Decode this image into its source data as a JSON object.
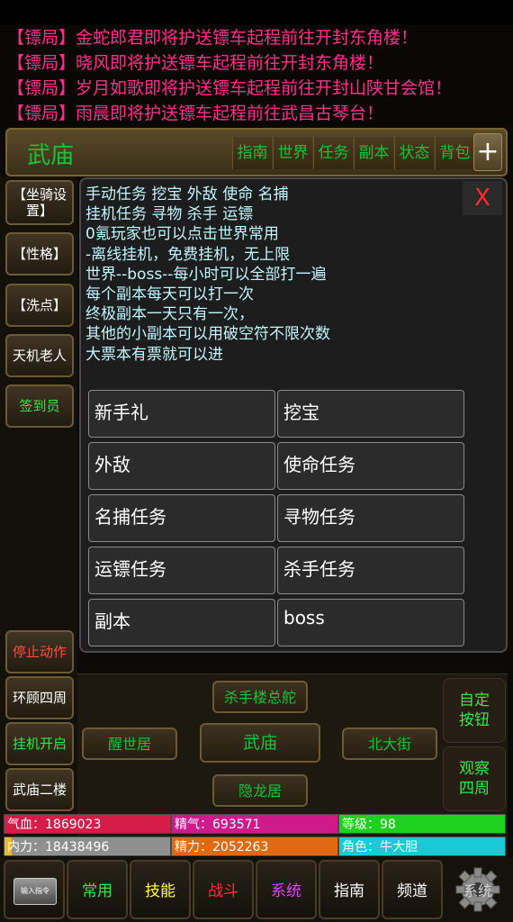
{
  "chat": {
    "lines": [
      "【镖局】金蛇郎君即将护送镖车起程前往开封东角楼！",
      "【镖局】晓风即将护送镖车起程前往开封东角楼！",
      "【镖局】岁月如歌即将护送镖车起程前往开封山陕甘会馆！",
      "【镖局】雨晨即将护送镖车起程前往武昌古琴台！"
    ]
  },
  "topbar": {
    "scene": "武庙",
    "tabs": [
      "指南",
      "世界",
      "任务",
      "副本",
      "状态",
      "背包"
    ],
    "plus": "+"
  },
  "sidebar": {
    "buttons": [
      "【坐骑设置】",
      "【性格】",
      "【洗点】",
      "天机老人",
      "签到员"
    ],
    "actions": [
      "停止动作",
      "环顾四周",
      "挂机开启",
      "武庙二楼"
    ]
  },
  "dialog": {
    "close": "X",
    "lines": [
      "手动任务 挖宝 外敌 使命 名捕",
      "挂机任务 寻物 杀手 运镖",
      "0氪玩家也可以点击世界常用",
      "-离线挂机，免费挂机，无上限",
      "世界--boss--每小时可以全部打一遍",
      "每个副本每天可以打一次",
      "终极副本一天只有一次，",
      "其他的小副本可以用破空符不限次数",
      "大票本有票就可以进"
    ],
    "options": [
      "新手礼",
      "挖宝",
      "外敌",
      "使命任务",
      "名捕任务",
      "寻物任务",
      "运镖任务",
      "杀手任务",
      "副本",
      "boss"
    ]
  },
  "map": {
    "north": "杀手楼总舵",
    "west": "醒世居",
    "center": "武庙",
    "east": "北大街",
    "south": "隐龙居",
    "custom": "自定按钮",
    "observe": "观察四周"
  },
  "stats": {
    "hp": "气血：1869023",
    "jingqi": "精气：693571",
    "level": "等级：98",
    "neili": "内力：18438496",
    "jingli": "精力：2052263",
    "role": "角色：牛大胆",
    "colors": {
      "hp": "#d81c4a",
      "jingqi": "#d01a8c",
      "level": "#1fd01f",
      "neili": "#8f8f8f",
      "jingli": "#e06a12",
      "role": "#19c9d4"
    }
  },
  "toolbar": {
    "cmd": "输入指令",
    "buttons": [
      "常用",
      "技能",
      "战斗",
      "系统",
      "指南",
      "频道"
    ],
    "colors": [
      "#39e34a",
      "#ffff33",
      "#ff3030",
      "#e040ff",
      "#ffffff",
      "#ffffff"
    ],
    "gear_label": "系统",
    "gear_icon": "gear-icon"
  }
}
